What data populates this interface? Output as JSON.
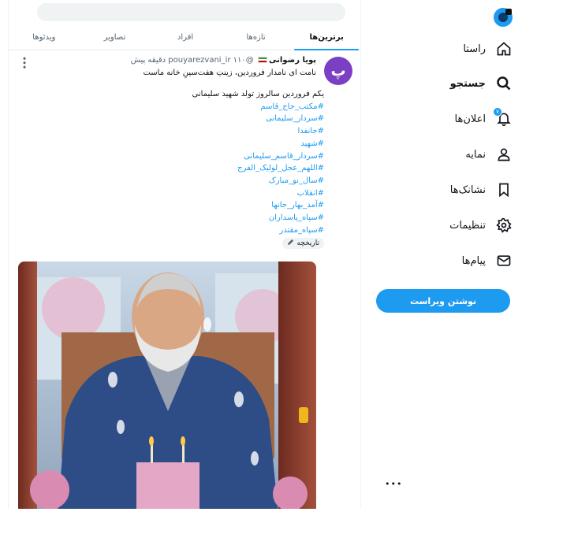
{
  "feed": {
    "tabs": [
      {
        "label": "برترین‌ها",
        "active": true
      },
      {
        "label": "تازه‌ها",
        "active": false
      },
      {
        "label": "افراد",
        "active": false
      },
      {
        "label": "تصاویر",
        "active": false
      },
      {
        "label": "ویدئوها",
        "active": false
      }
    ],
    "post": {
      "avatar_letter": "پ",
      "author_name": "پویا رضوانی",
      "handle": "@pouyarezvani_ir",
      "time": "۱۱۰ دقیقه پیش",
      "bio": "نامت ای نامدار فروردین، زینتِ هفت‌سینِ خانه ماست",
      "text_line": "یکم فروردین سالروز تولد شهید سلیمانی",
      "hashtags": [
        "#مکتب_حاج_قاسم",
        "#سردار_سلیمانی",
        "#جانفدا",
        "#شهید",
        "#سردار_قاسم_سلیمانی",
        "#اللهم_عجل_لولیک_الفرج",
        "#سال_نو_مبارک",
        "#انقلاب",
        "#آمد_بهار_جانها",
        "#سپاه_پاسداران",
        "#سپاه_مقتدر"
      ],
      "history_chip": "تاریخچه"
    }
  },
  "sidebar": {
    "items": [
      {
        "label": "راستا",
        "icon": "home-icon",
        "active": false
      },
      {
        "label": "جستجو",
        "icon": "search-icon",
        "active": true
      },
      {
        "label": "اعلان‌ها",
        "icon": "bell-icon",
        "active": false,
        "badge": "۷"
      },
      {
        "label": "نمایه",
        "icon": "user-icon",
        "active": false
      },
      {
        "label": "نشانک‌ها",
        "icon": "bookmark-icon",
        "active": false
      },
      {
        "label": "تنظیمات",
        "icon": "gear-icon",
        "active": false
      },
      {
        "label": "پیام‌ها",
        "icon": "mail-icon",
        "active": false
      }
    ],
    "compose_label": "نوشتن ویراست",
    "account_menu": "•••"
  },
  "colors": {
    "accent": "#1d9bf0",
    "avatar": "#7b3fc4",
    "text": "#0f1419",
    "muted": "#536471"
  }
}
